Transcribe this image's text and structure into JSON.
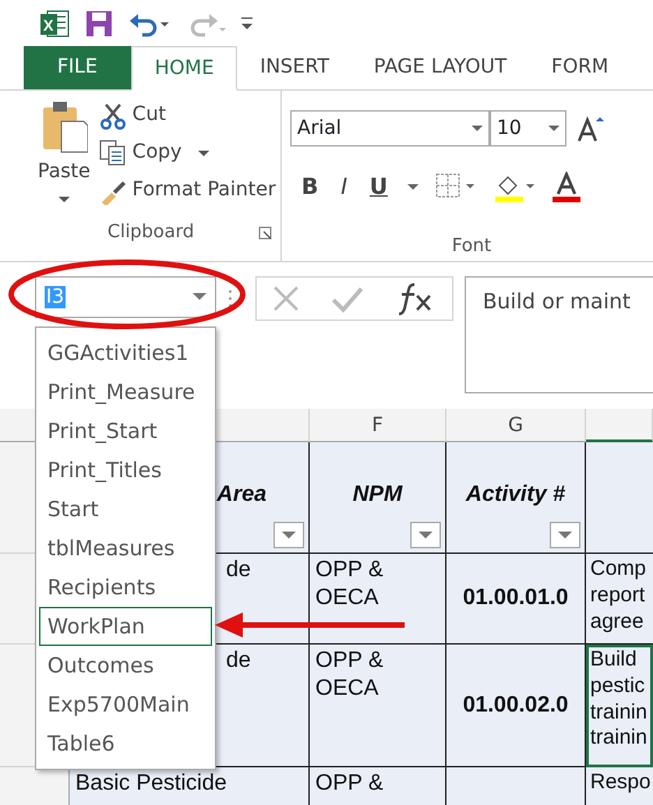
{
  "quick_access": {
    "undo_enabled": true,
    "redo_enabled": false
  },
  "tabs": [
    {
      "label": "FILE",
      "kind": "file",
      "selected": false
    },
    {
      "label": "HOME",
      "kind": "tab",
      "selected": true
    },
    {
      "label": "INSERT",
      "kind": "tab",
      "selected": false
    },
    {
      "label": "PAGE LAYOUT",
      "kind": "tab",
      "selected": false
    },
    {
      "label": "FORM",
      "kind": "tab",
      "selected": false
    }
  ],
  "clipboard": {
    "paste": "Paste",
    "cut": "Cut",
    "copy": "Copy",
    "format_painter": "Format Painter",
    "group_label": "Clipboard"
  },
  "font": {
    "name": "Arial",
    "size": "10",
    "bold": "B",
    "italic": "I",
    "underline": "U",
    "group_label": "Font"
  },
  "name_box": {
    "value": "I3",
    "expanded": true
  },
  "formula": {
    "value": "Build or maint"
  },
  "name_list": [
    {
      "label": "GGActivities1",
      "selected": false
    },
    {
      "label": "Print_Measure",
      "selected": false
    },
    {
      "label": "Print_Start",
      "selected": false
    },
    {
      "label": "Print_Titles",
      "selected": false
    },
    {
      "label": "Start",
      "selected": false
    },
    {
      "label": "tblMeasures",
      "selected": false
    },
    {
      "label": "Recipients",
      "selected": false
    },
    {
      "label": "WorkPlan",
      "selected": true
    },
    {
      "label": "Outcomes",
      "selected": false
    },
    {
      "label": "Exp5700Main",
      "selected": false
    },
    {
      "label": "Table6",
      "selected": false
    }
  ],
  "app_icon": {
    "letter": "X"
  },
  "columns": [
    {},
    {
      "letter": "F"
    },
    {
      "letter": "G"
    },
    {}
  ],
  "table": {
    "headers": [
      {
        "text": "Area"
      },
      {
        "text": "NPM"
      },
      {
        "text": "Activity #"
      }
    ],
    "rows": [
      [
        "de",
        "OPP &\nOECA",
        "01.00.01.0",
        "Comp\nreport\nagree"
      ],
      [
        "de",
        "OPP &\nOECA",
        "01.00.02.0",
        "Build\npestic\ntrainin\ntrainin"
      ],
      [
        "Basic Pesticide",
        "OPP &",
        "",
        "Respo"
      ]
    ]
  }
}
